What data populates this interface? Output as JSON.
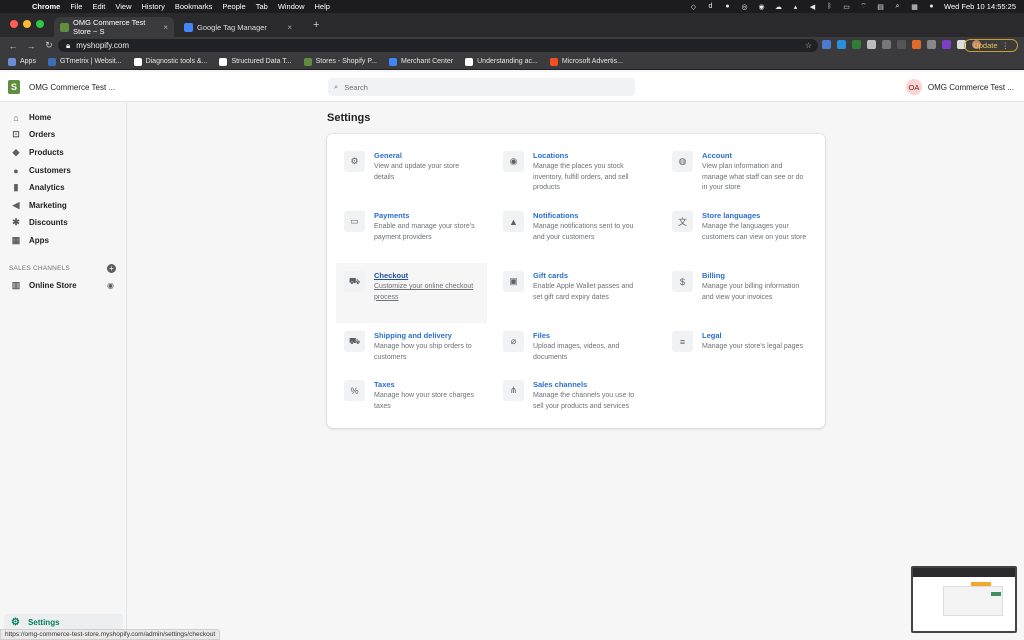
{
  "mac_menu": {
    "apple": "",
    "items": [
      "Chrome",
      "File",
      "Edit",
      "View",
      "History",
      "Bookmarks",
      "People",
      "Tab",
      "Window",
      "Help"
    ],
    "clock": "Wed Feb 10  14:55:25"
  },
  "browser": {
    "tabs": [
      {
        "title": "OMG Commerce Test Store ~ S",
        "close": "×",
        "favicon_color": "#5e8e3e",
        "active": true
      },
      {
        "title": "Google Tag Manager",
        "close": "×",
        "favicon_color": "#4285f4",
        "active": false
      }
    ],
    "new_tab": "+",
    "back": "←",
    "forward": "→",
    "reload": "↻",
    "url": "myshopify.com",
    "star": "☆",
    "update_label": "Update",
    "bookmarks": [
      {
        "label": "Apps",
        "icon_color": "#6b8dd6"
      },
      {
        "label": "GTmetrix | Websit...",
        "icon_color": "#3a6fb4"
      },
      {
        "label": "Diagnostic tools &...",
        "icon_color": "#ffffff"
      },
      {
        "label": "Structured Data T...",
        "icon_color": "#ffffff"
      },
      {
        "label": "Stores - Shopify P...",
        "icon_color": "#5e8e3e"
      },
      {
        "label": "Merchant Center",
        "icon_color": "#4285f4"
      },
      {
        "label": "Understanding ac...",
        "icon_color": "#ffffff"
      },
      {
        "label": "Microsoft Advertis...",
        "icon_color": "#f25022"
      }
    ]
  },
  "topbar": {
    "logo": "S",
    "store_name": "OMG Commerce Test ...",
    "search_icon": "⌕",
    "search_placeholder": "Search",
    "user_initials": "OA",
    "user_name": "OMG Commerce Test ..."
  },
  "sidebar": {
    "items": [
      {
        "label": "Home",
        "icon": "home-icon",
        "glyph": "⌂"
      },
      {
        "label": "Orders",
        "icon": "orders-icon",
        "glyph": "⊡"
      },
      {
        "label": "Products",
        "icon": "tag-icon",
        "glyph": "◆"
      },
      {
        "label": "Customers",
        "icon": "person-icon",
        "glyph": "●"
      },
      {
        "label": "Analytics",
        "icon": "bar-chart-icon",
        "glyph": "▮"
      },
      {
        "label": "Marketing",
        "icon": "megaphone-icon",
        "glyph": "◀"
      },
      {
        "label": "Discounts",
        "icon": "discount-icon",
        "glyph": "✱"
      },
      {
        "label": "Apps",
        "icon": "apps-icon",
        "glyph": "▦"
      }
    ],
    "channels_label": "SALES CHANNELS",
    "add_channel": "+",
    "online_store": {
      "label": "Online Store",
      "icon": "store-icon",
      "glyph": "▥",
      "eye": "◉"
    },
    "settings": {
      "label": "Settings",
      "icon": "gear-icon",
      "glyph": "⚙"
    }
  },
  "page": {
    "title": "Settings",
    "settings": [
      {
        "title": "General",
        "desc": "View and update your store details",
        "icon": "gear-icon",
        "glyph": "⚙"
      },
      {
        "title": "Locations",
        "desc": "Manage the places you stock inventory, fulfill orders, and sell products",
        "icon": "location-pin-icon",
        "glyph": "◉"
      },
      {
        "title": "Account",
        "desc": "View plan information and manage what staff can see or do in your store",
        "icon": "account-icon",
        "glyph": "◍"
      },
      {
        "title": "Payments",
        "desc": "Enable and manage your store's payment providers",
        "icon": "payments-icon",
        "glyph": "▭"
      },
      {
        "title": "Notifications",
        "desc": "Manage notifications sent to you and your customers",
        "icon": "bell-icon",
        "glyph": "▲"
      },
      {
        "title": "Store languages",
        "desc": "Manage the languages your customers can view on your store",
        "icon": "translate-icon",
        "glyph": "文"
      },
      {
        "title": "Checkout",
        "desc": "Customize your online checkout process",
        "icon": "cart-icon",
        "glyph": "⛟",
        "hover": true
      },
      {
        "title": "Gift cards",
        "desc": "Enable Apple Wallet passes and set gift card expiry dates",
        "icon": "gift-icon",
        "glyph": "▣"
      },
      {
        "title": "Billing",
        "desc": "Manage your billing information and view your invoices",
        "icon": "billing-icon",
        "glyph": "$"
      },
      {
        "title": "Shipping and delivery",
        "desc": "Manage how you ship orders to customers",
        "icon": "truck-icon",
        "glyph": "⛟"
      },
      {
        "title": "Files",
        "desc": "Upload images, videos, and documents",
        "icon": "paperclip-icon",
        "glyph": "⌀"
      },
      {
        "title": "Legal",
        "desc": "Manage your store's legal pages",
        "icon": "legal-icon",
        "glyph": "≡"
      },
      {
        "title": "Taxes",
        "desc": "Manage how your store charges taxes",
        "icon": "tax-icon",
        "glyph": "%"
      },
      {
        "title": "Sales channels",
        "desc": "Manage the channels you use to sell your products and services",
        "icon": "channels-icon",
        "glyph": "⋔"
      }
    ]
  },
  "status_url": "https://omg-commerce-test-store.myshopify.com/admin/settings/checkout"
}
